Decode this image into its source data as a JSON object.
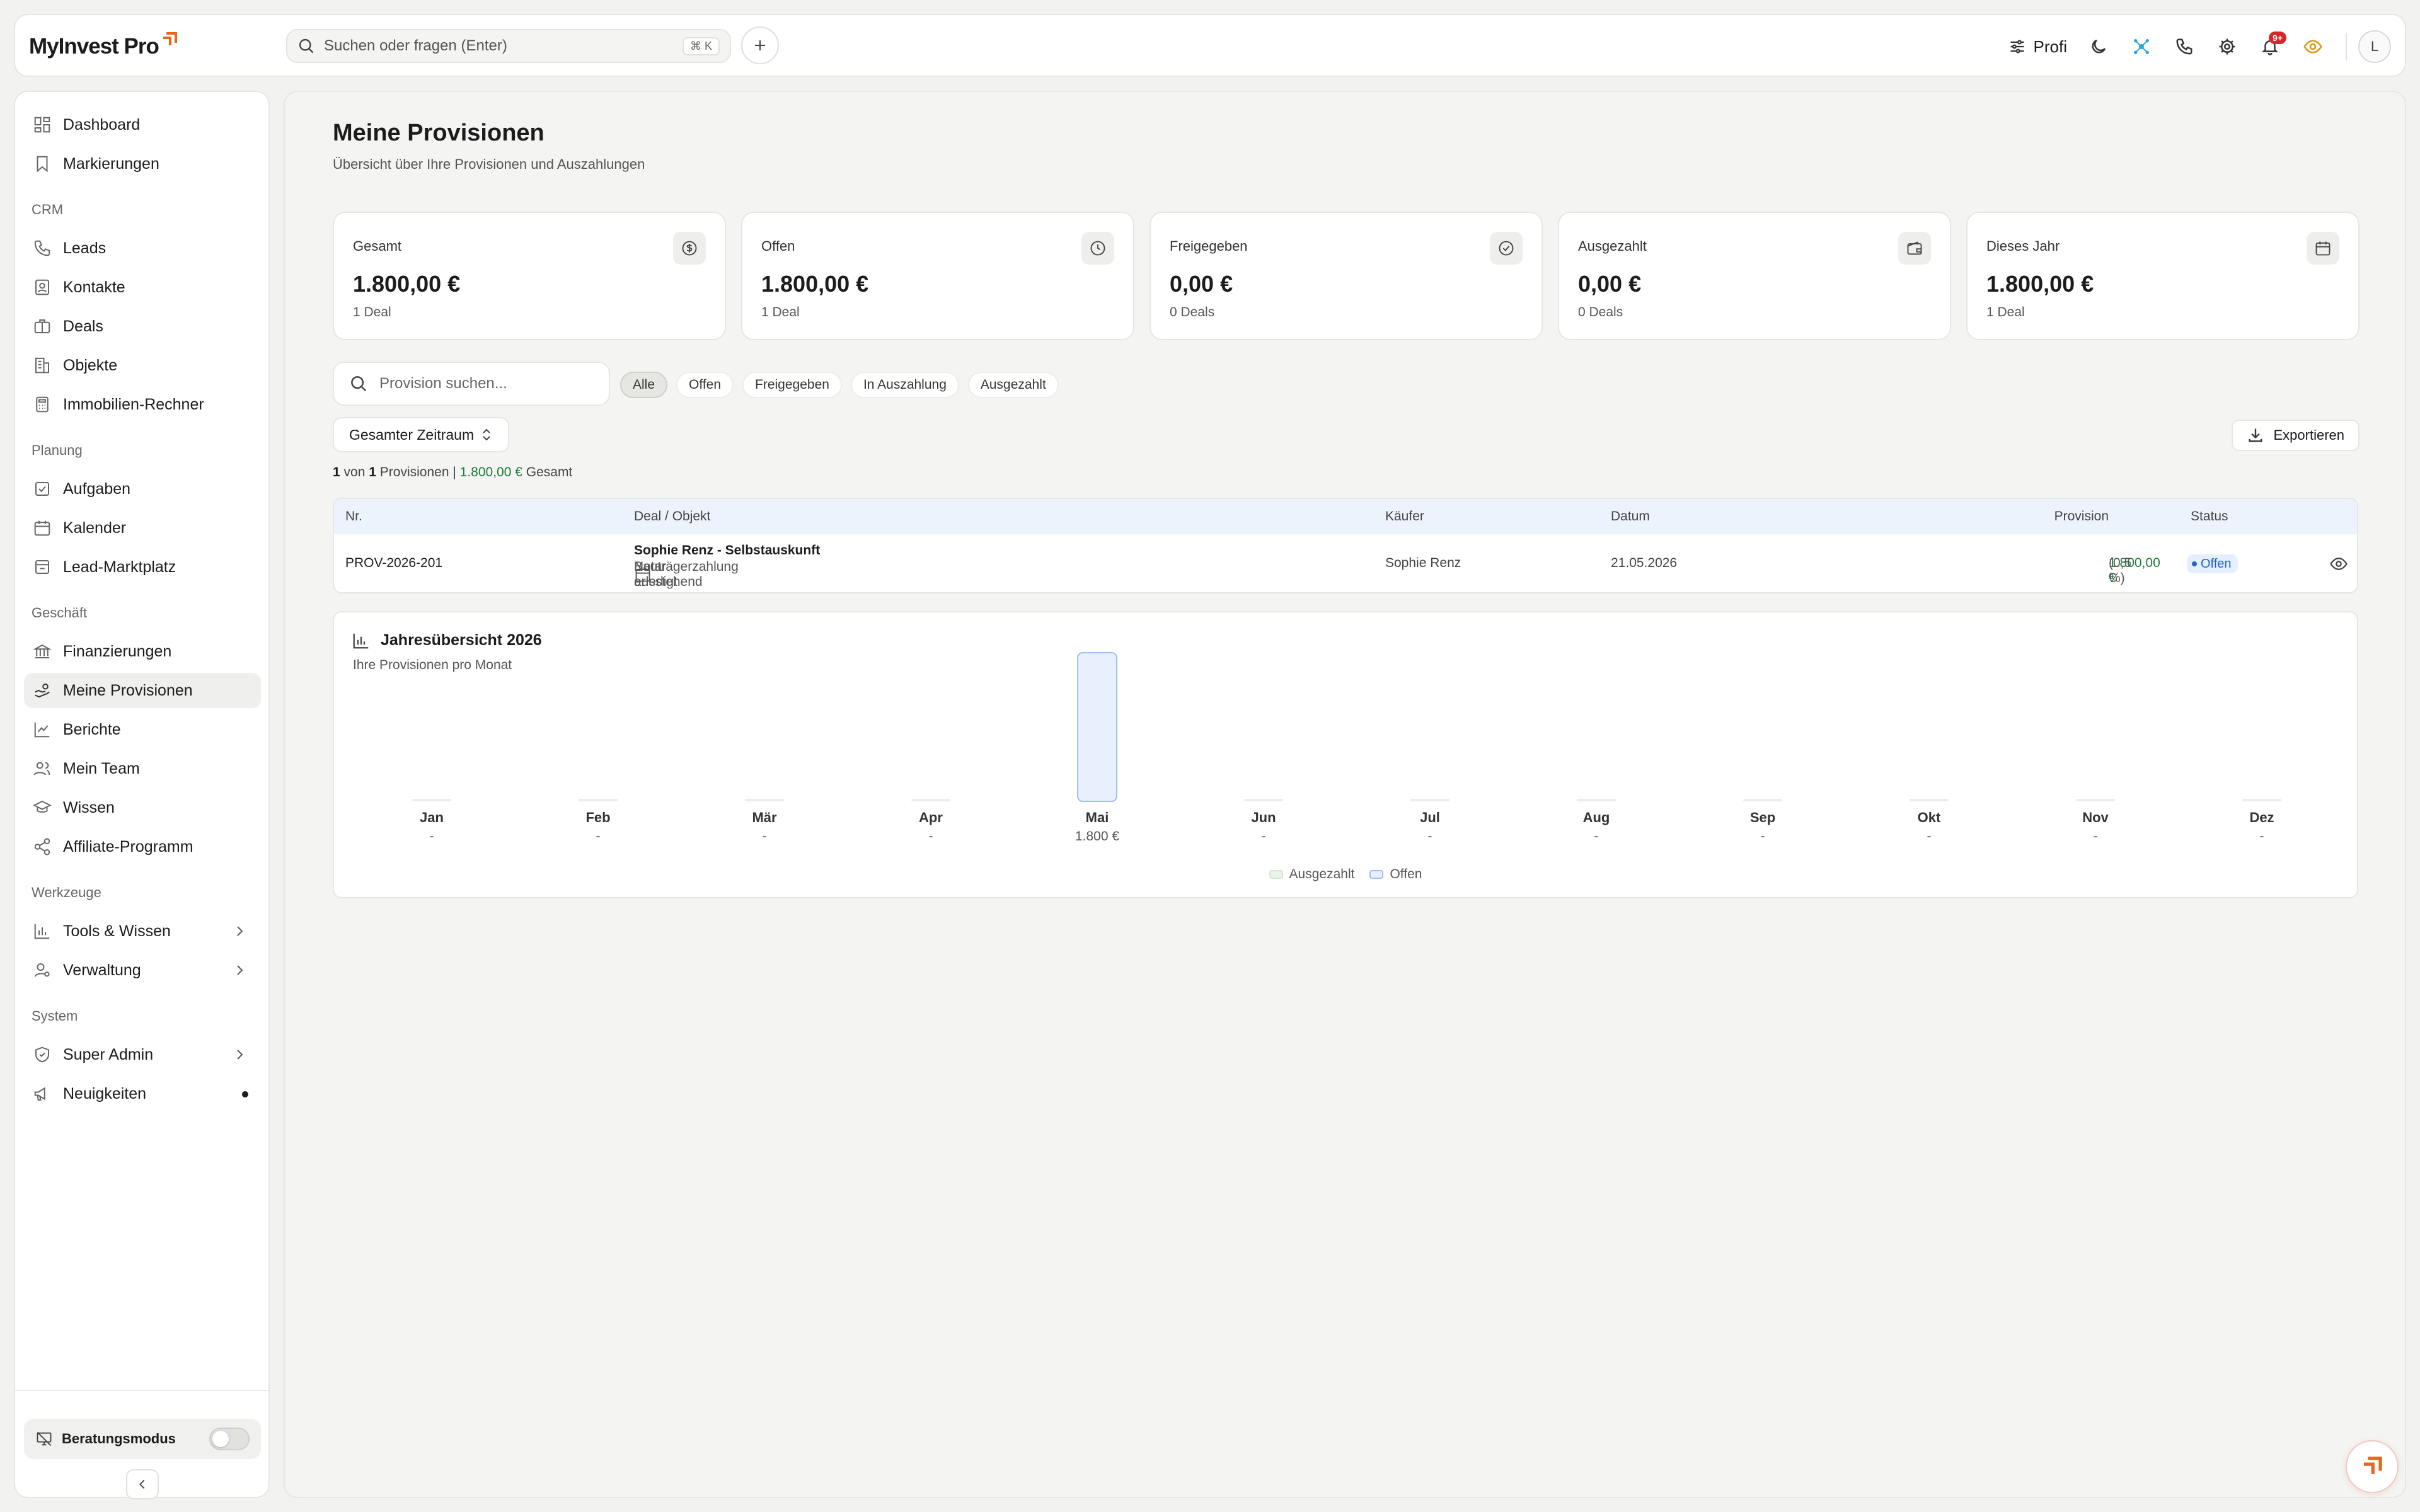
{
  "app": {
    "name": "MyInvest Pro"
  },
  "topbar": {
    "search_placeholder": "Suchen oder fragen (Enter)",
    "search_shortcut": "⌘ K",
    "profile_mode": "Profi",
    "notification_count": "9+",
    "avatar_initial": "L"
  },
  "sidebar": {
    "items_top": [
      {
        "label": "Dashboard",
        "icon": "grid-icon"
      },
      {
        "label": "Markierungen",
        "icon": "bookmark-icon"
      }
    ],
    "sections": [
      {
        "title": "CRM",
        "items": [
          {
            "label": "Leads",
            "icon": "phone-icon"
          },
          {
            "label": "Kontakte",
            "icon": "contact-icon"
          },
          {
            "label": "Deals",
            "icon": "briefcase-icon"
          },
          {
            "label": "Objekte",
            "icon": "building-icon"
          },
          {
            "label": "Immobilien-Rechner",
            "icon": "calculator-icon"
          }
        ]
      },
      {
        "title": "Planung",
        "items": [
          {
            "label": "Aufgaben",
            "icon": "checkbox-icon"
          },
          {
            "label": "Kalender",
            "icon": "calendar-icon"
          },
          {
            "label": "Lead-Marktplatz",
            "icon": "store-icon"
          }
        ]
      },
      {
        "title": "Geschäft",
        "items": [
          {
            "label": "Finanzierungen",
            "icon": "bank-icon"
          },
          {
            "label": "Meine Provisionen",
            "icon": "hand-coins-icon"
          },
          {
            "label": "Berichte",
            "icon": "line-chart-icon"
          },
          {
            "label": "Mein Team",
            "icon": "users-icon"
          },
          {
            "label": "Wissen",
            "icon": "graduation-icon"
          },
          {
            "label": "Affiliate-Programm",
            "icon": "share-icon"
          }
        ]
      },
      {
        "title": "Werkzeuge",
        "items": [
          {
            "label": "Tools & Wissen",
            "icon": "bar-chart-icon"
          },
          {
            "label": "Verwaltung",
            "icon": "user-cog-icon"
          }
        ]
      },
      {
        "title": "System",
        "items": [
          {
            "label": "Super Admin",
            "icon": "shield-icon"
          },
          {
            "label": "Neuigkeiten",
            "icon": "megaphone-icon"
          }
        ]
      }
    ],
    "active_item": "Meine Provisionen",
    "consult_mode_label": "Beratungsmodus"
  },
  "page": {
    "title": "Meine Provisionen",
    "subtitle": "Übersicht über Ihre Provisionen und Auszahlungen"
  },
  "stats": [
    {
      "label": "Gesamt",
      "value": "1.800,00 €",
      "sub": "1 Deal",
      "icon": "dollar-circle-icon"
    },
    {
      "label": "Offen",
      "value": "1.800,00 €",
      "sub": "1 Deal",
      "icon": "clock-icon"
    },
    {
      "label": "Freigegeben",
      "value": "0,00 €",
      "sub": "0 Deals",
      "icon": "check-circle-icon"
    },
    {
      "label": "Ausgezahlt",
      "value": "0,00 €",
      "sub": "0 Deals",
      "icon": "wallet-icon"
    },
    {
      "label": "Dieses Jahr",
      "value": "1.800,00 €",
      "sub": "1 Deal",
      "icon": "calendar-icon"
    }
  ],
  "filters": {
    "search_placeholder": "Provision suchen...",
    "chips": [
      "Alle",
      "Offen",
      "Freigegeben",
      "In Auszahlung",
      "Ausgezahlt"
    ],
    "active_chip": "Alle",
    "period": "Gesamter Zeitraum",
    "export_label": "Exportieren"
  },
  "summary": {
    "shown": "1",
    "of_text": "von",
    "total": "1",
    "unit": "Provisionen |",
    "amount": "1.800,00 €",
    "suffix": "Gesamt"
  },
  "table": {
    "headers": {
      "nr": "Nr.",
      "deal": "Deal / Objekt",
      "buyer": "Käufer",
      "date": "Datum",
      "commission": "Provision",
      "status": "Status"
    },
    "rows": [
      {
        "nr": "PROV-2026-201",
        "deal": "Sophie Renz - Selbstauskunft",
        "deal_meta_1": "Notar erledigt",
        "deal_meta_sep": "·",
        "deal_meta_2": "Bauträgerzahlung ausstehend",
        "buyer": "Sophie Renz",
        "date": "21.05.2026",
        "commission": "1.800,00 €",
        "commission_rate": "(0,5 %)",
        "status": "Offen"
      }
    ]
  },
  "chart_data": {
    "type": "bar",
    "title": "Jahresübersicht 2026",
    "subtitle": "Ihre Provisionen pro Monat",
    "categories": [
      "Jan",
      "Feb",
      "Mär",
      "Apr",
      "Mai",
      "Jun",
      "Jul",
      "Aug",
      "Sep",
      "Okt",
      "Nov",
      "Dez"
    ],
    "value_labels": [
      "-",
      "-",
      "-",
      "-",
      "1.800 €",
      "-",
      "-",
      "-",
      "-",
      "-",
      "-",
      "-"
    ],
    "series": [
      {
        "name": "Ausgezahlt",
        "values": [
          0,
          0,
          0,
          0,
          0,
          0,
          0,
          0,
          0,
          0,
          0,
          0
        ],
        "color": "#eaf2ea"
      },
      {
        "name": "Offen",
        "values": [
          0,
          0,
          0,
          0,
          1800,
          0,
          0,
          0,
          0,
          0,
          0,
          0
        ],
        "color": "#e8f0fd"
      }
    ],
    "stacked": true,
    "ylim": [
      0,
      1800
    ],
    "grid": false,
    "legend": "bottom-center"
  }
}
